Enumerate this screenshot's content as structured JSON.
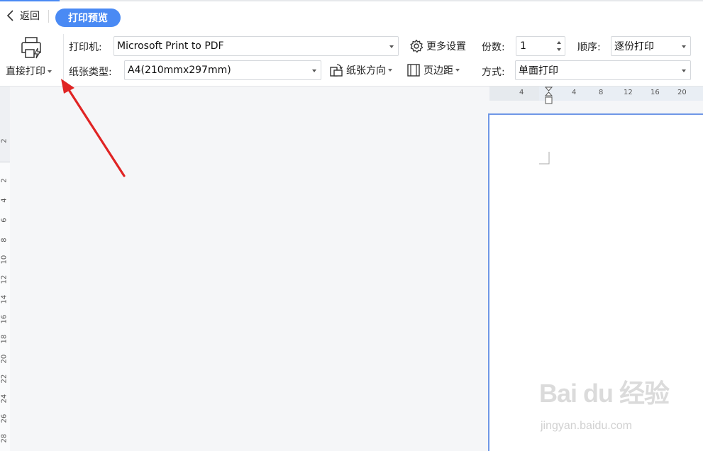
{
  "titlebar": {
    "back_label": "返回",
    "active_tab": "打印预览"
  },
  "toolbar": {
    "direct_print_label": "直接打印",
    "printer_label": "打印机:",
    "printer_value": "Microsoft Print to PDF",
    "paper_type_label": "纸张类型:",
    "paper_type_value": "A4(210mmx297mm)",
    "more_settings_label": "更多设置",
    "orientation_label": "纸张方向",
    "margins_label": "页边距",
    "copies_label": "份数:",
    "copies_value": "1",
    "order_label": "顺序:",
    "order_value": "逐份打印",
    "mode_label": "方式:",
    "mode_value": "单面打印"
  },
  "ruler": {
    "horizontal_ticks": [
      "4",
      "4",
      "8",
      "12",
      "16",
      "20"
    ],
    "vertical_ticks": [
      "2",
      "2",
      "4",
      "6",
      "8",
      "10",
      "12",
      "14",
      "16",
      "18",
      "20",
      "22",
      "24",
      "26",
      "28"
    ]
  },
  "watermark": {
    "brand": "Bai du 经验",
    "url": "jingyan.baidu.com"
  },
  "colors": {
    "accent": "#4a8af4",
    "page_border": "#6f97e6",
    "arrow": "#e02424"
  }
}
